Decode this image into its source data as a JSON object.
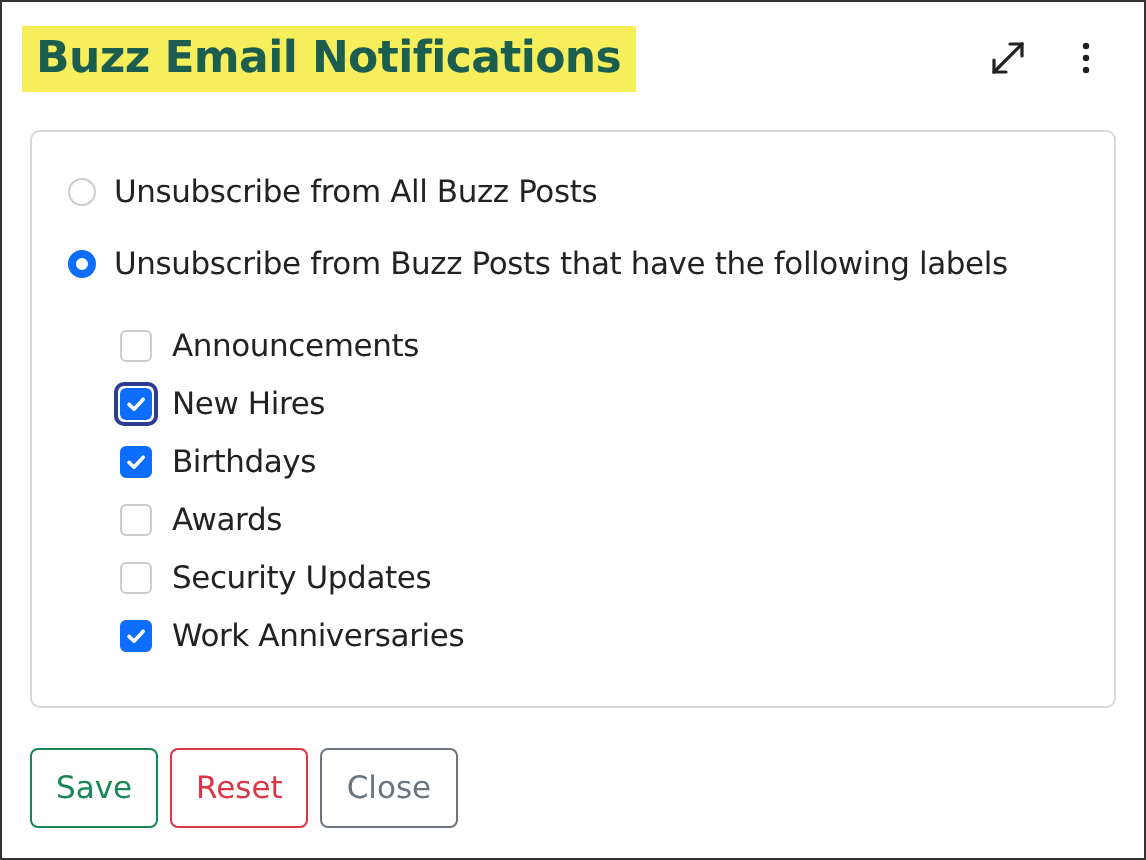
{
  "header": {
    "title": "Buzz Email Notifications"
  },
  "options": [
    {
      "label": "Unsubscribe from All Buzz Posts",
      "selected": false
    },
    {
      "label": "Unsubscribe from Buzz Posts that have the following labels",
      "selected": true
    }
  ],
  "labels": [
    {
      "label": "Announcements",
      "checked": false,
      "focused": false
    },
    {
      "label": "New Hires",
      "checked": true,
      "focused": true
    },
    {
      "label": "Birthdays",
      "checked": true,
      "focused": false
    },
    {
      "label": "Awards",
      "checked": false,
      "focused": false
    },
    {
      "label": "Security Updates",
      "checked": false,
      "focused": false
    },
    {
      "label": "Work Anniversaries",
      "checked": true,
      "focused": false
    }
  ],
  "buttons": [
    {
      "label": "Save",
      "kind": "save"
    },
    {
      "label": "Reset",
      "kind": "reset"
    },
    {
      "label": "Close",
      "kind": "close"
    }
  ]
}
